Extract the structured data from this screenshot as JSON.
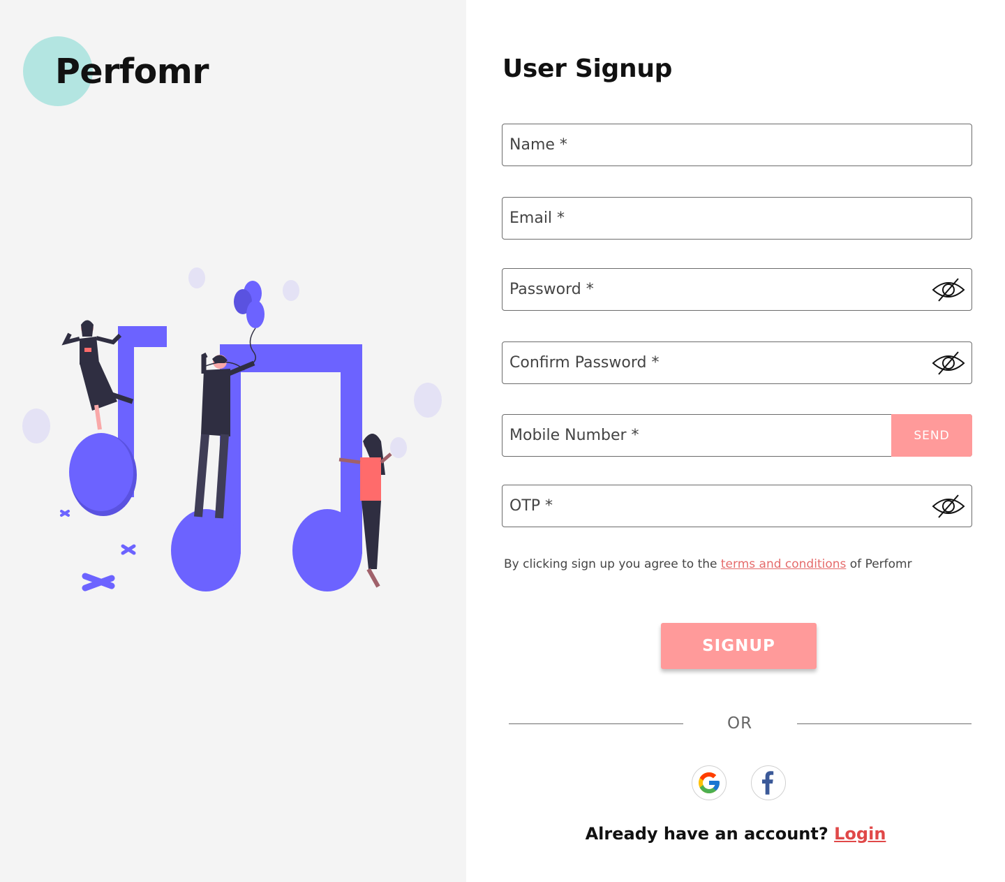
{
  "brand": {
    "name": "Perfomr",
    "circle_color": "#b3e5e1"
  },
  "form": {
    "title": "User Signup",
    "name_placeholder": "Name *",
    "email_placeholder": "Email *",
    "password_placeholder": "Password *",
    "confirm_password_placeholder": "Confirm Password *",
    "mobile_placeholder": "Mobile Number *",
    "send_label": "SEND",
    "otp_placeholder": "OTP *",
    "terms_prefix": "By clicking sign up you agree to the ",
    "terms_link": "terms and conditions",
    "terms_suffix": " of Perfomr",
    "signup_label": "SIGNUP",
    "or_label": "OR",
    "login_prompt": "Already have an account? ",
    "login_link": "Login"
  },
  "icons": {
    "password_toggle": "eye-slash-icon",
    "google": "google-icon",
    "facebook": "facebook-icon"
  },
  "colors": {
    "accent": "#ff9a9a",
    "link": "#e04848",
    "illustration": "#6c63ff",
    "left_panel_bg": "#f4f4f4"
  }
}
